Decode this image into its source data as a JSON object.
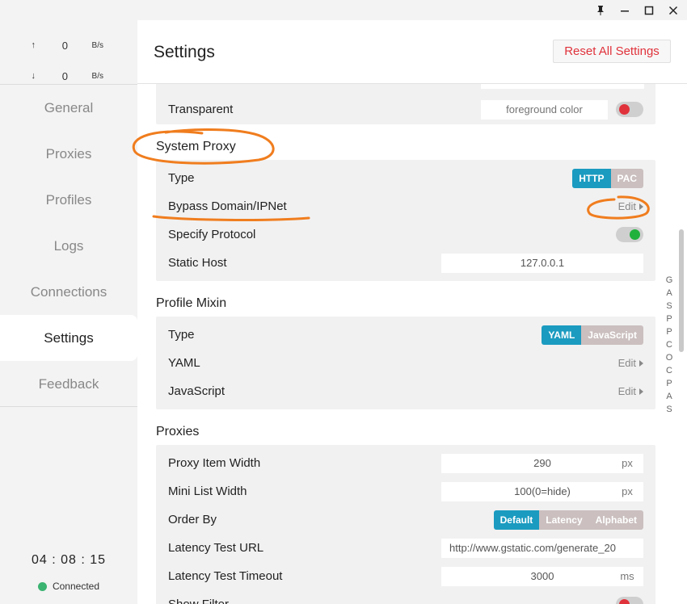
{
  "traffic": {
    "up_arrow": "↑",
    "up_value": "0",
    "up_unit": "B/s",
    "down_arrow": "↓",
    "down_value": "0",
    "down_unit": "B/s"
  },
  "nav": {
    "items": [
      {
        "label": "General"
      },
      {
        "label": "Proxies"
      },
      {
        "label": "Profiles"
      },
      {
        "label": "Logs"
      },
      {
        "label": "Connections"
      },
      {
        "label": "Settings"
      },
      {
        "label": "Feedback"
      }
    ],
    "active": "Settings"
  },
  "status": {
    "clock": "04 : 08 : 15",
    "connection": "Connected",
    "connected_color": "#3bb371"
  },
  "header": {
    "title": "Settings",
    "reset_label": "Reset All Settings"
  },
  "appearance": {
    "transparent_label": "Transparent",
    "transparent_placeholder": "foreground color"
  },
  "system_proxy": {
    "title": "System Proxy",
    "type_label": "Type",
    "type_options": [
      "HTTP",
      "PAC"
    ],
    "type_selected": "HTTP",
    "bypass_label": "Bypass Domain/IPNet",
    "bypass_action": "Edit",
    "protocol_label": "Specify Protocol",
    "protocol_enabled": true,
    "static_host_label": "Static Host",
    "static_host_value": "127.0.0.1"
  },
  "profile_mixin": {
    "title": "Profile Mixin",
    "type_label": "Type",
    "type_options": [
      "YAML",
      "JavaScript"
    ],
    "type_selected": "YAML",
    "yaml_label": "YAML",
    "yaml_action": "Edit",
    "js_label": "JavaScript",
    "js_action": "Edit"
  },
  "proxies": {
    "title": "Proxies",
    "item_width_label": "Proxy Item Width",
    "item_width_value": "290",
    "item_width_unit": "px",
    "mini_width_label": "Mini List Width",
    "mini_width_value": "100(0=hide)",
    "mini_width_unit": "px",
    "order_label": "Order By",
    "order_options": [
      "Default",
      "Latency",
      "Alphabet"
    ],
    "order_selected": "Default",
    "latency_url_label": "Latency Test URL",
    "latency_url_value": "http://www.gstatic.com/generate_20",
    "latency_timeout_label": "Latency Test Timeout",
    "latency_timeout_value": "3000",
    "latency_timeout_unit": "ms",
    "show_filter_label": "Show Filter"
  },
  "alpha_index": [
    "G",
    "A",
    "S",
    "P",
    "P",
    "C",
    "O",
    "C",
    "P",
    "A",
    "S"
  ],
  "colors": {
    "accent": "#1b9bc0",
    "danger": "#e0323b",
    "success": "#1fb13c",
    "annotation": "#f07d1e"
  }
}
